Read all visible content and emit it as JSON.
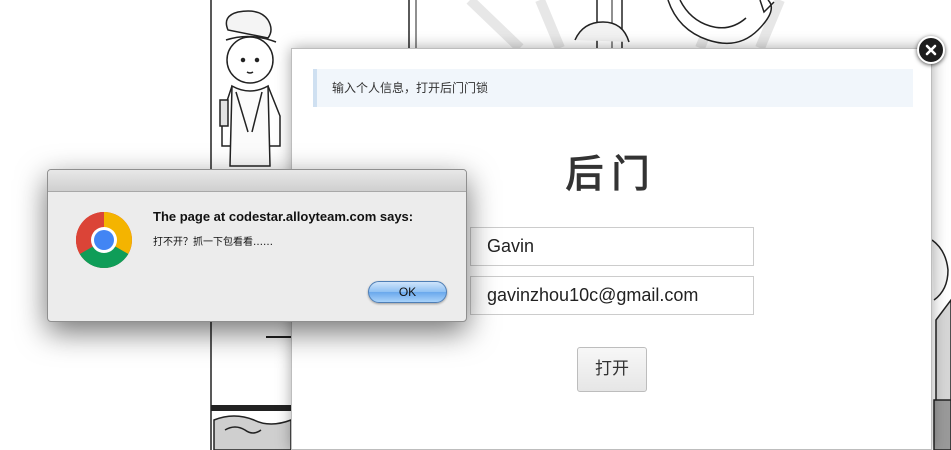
{
  "background": {
    "description_icon": "manga-comic-panels"
  },
  "modal": {
    "info_text": "输入个人信息，打开后门门锁",
    "title": "后门",
    "name_value": "Gavin",
    "email_value": "gavinzhou10c@gmail.com",
    "open_button_label": "打开",
    "close_icon": "close-icon"
  },
  "alert": {
    "heading": "The page at codestar.alloyteam.com says:",
    "message": "打不开？抓一下包看看……",
    "ok_label": "OK",
    "icon": "chrome-logo-icon"
  },
  "colors": {
    "info_bar_bg": "#f1f6fb",
    "info_bar_border": "#cfe0f1",
    "ok_button_blue": "#6aa8ec"
  }
}
